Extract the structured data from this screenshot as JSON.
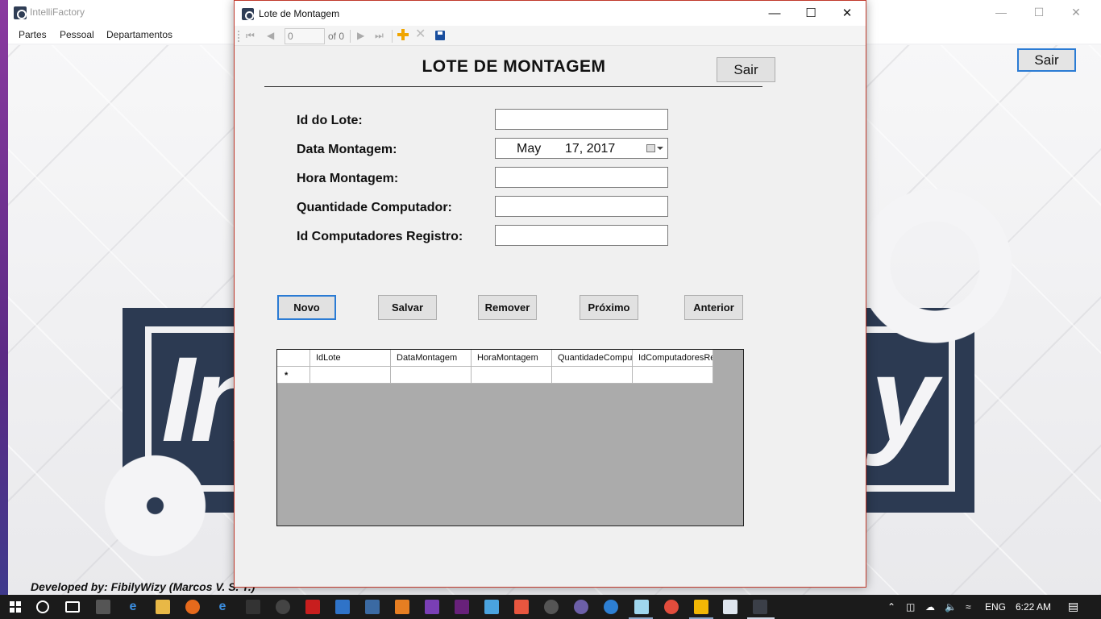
{
  "main_window": {
    "title": "IntelliFactory",
    "menu": [
      "Partes",
      "Pessoal",
      "Departamentos"
    ],
    "sair_label": "Sair",
    "developer_text": "Developed by: FibilyWizy (Marcos V. S. T.)",
    "logo_letters_left": "In",
    "logo_letters_right": "y"
  },
  "dialog": {
    "title": "Lote de Montagem",
    "navigator": {
      "position_value": "0",
      "count_text": "of 0"
    },
    "heading": "LOTE DE MONTAGEM",
    "sair_label": "Sair",
    "fields": {
      "id_lote_label": "Id do Lote:",
      "data_montagem_label": "Data Montagem:",
      "data_month": "May",
      "data_day_year": "17, 2017",
      "hora_montagem_label": "Hora Montagem:",
      "quantidade_label": "Quantidade Computador:",
      "id_computadores_label": "Id Computadores Registro:"
    },
    "buttons": {
      "novo": "Novo",
      "salvar": "Salvar",
      "remover": "Remover",
      "proximo": "Próximo",
      "anterior": "Anterior"
    },
    "grid": {
      "columns": [
        "IdLote",
        "DataMontagem",
        "HoraMontagem",
        "QuantidadeComput",
        "IdComputadoresRe"
      ],
      "new_row_marker": "*"
    }
  },
  "taskbar": {
    "language": "ENG",
    "time": "6:22 AM"
  },
  "colors": {
    "accent_blue": "#2a7bd4",
    "logo_navy": "#2c3a52",
    "dialog_border": "#c0392b",
    "grid_bg": "#ababab"
  }
}
